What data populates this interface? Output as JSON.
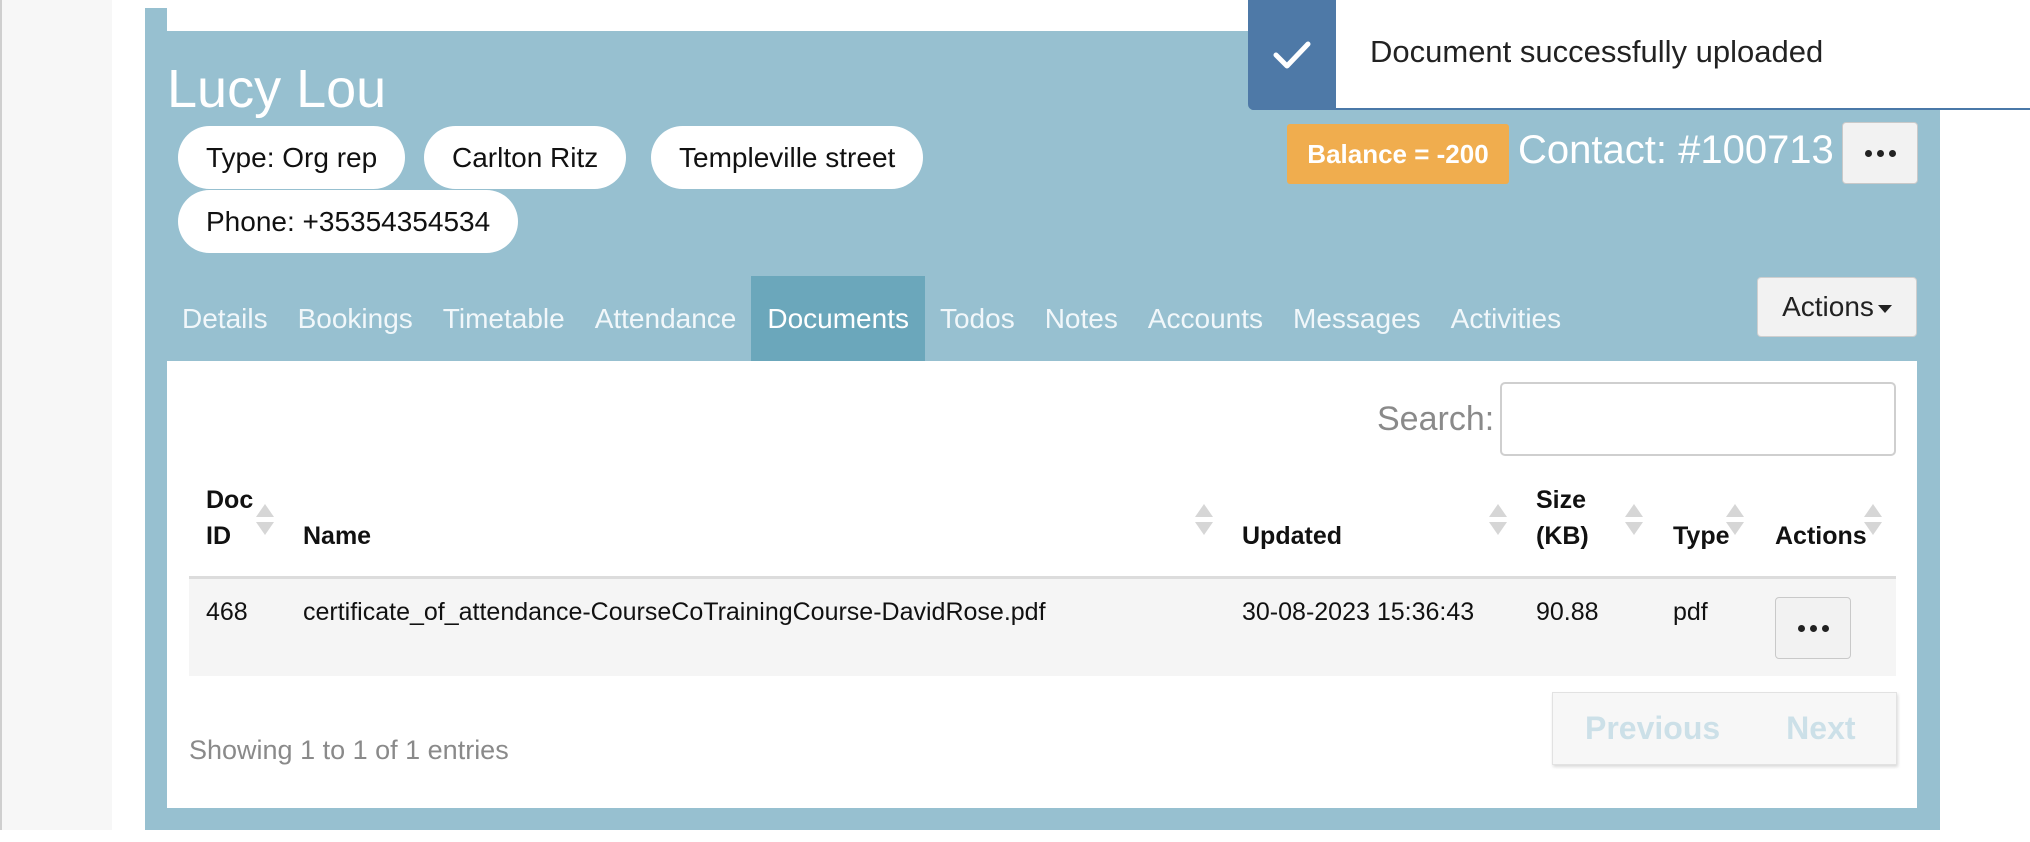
{
  "contact": {
    "name": "Lucy Lou",
    "pills": [
      "Type: Org rep",
      "Carlton Ritz",
      "Templeville street",
      "Phone: +35354354534"
    ],
    "balance": "Balance = -200",
    "contact_id": "Contact: #100713"
  },
  "tabs": [
    {
      "label": "Details",
      "active": false
    },
    {
      "label": "Bookings",
      "active": false
    },
    {
      "label": "Timetable",
      "active": false
    },
    {
      "label": "Attendance",
      "active": false
    },
    {
      "label": "Documents",
      "active": true
    },
    {
      "label": "Todos",
      "active": false
    },
    {
      "label": "Notes",
      "active": false
    },
    {
      "label": "Accounts",
      "active": false
    },
    {
      "label": "Messages",
      "active": false
    },
    {
      "label": "Activities",
      "active": false
    }
  ],
  "actions_label": "Actions",
  "search": {
    "label": "Search:",
    "value": ""
  },
  "table": {
    "headers": {
      "doc_id_1": "Doc",
      "doc_id_2": "ID",
      "name": "Name",
      "updated": "Updated",
      "size_1": "Size",
      "size_2": "(KB)",
      "type": "Type",
      "actions": "Actions"
    },
    "rows": [
      {
        "doc_id": "468",
        "name": "certificate_of_attendance-CourseCoTrainingCourse-DavidRose.pdf",
        "updated": "30-08-2023 15:36:43",
        "size": "90.88",
        "type": "pdf"
      }
    ]
  },
  "footer": {
    "showing": "Showing 1 to 1 of 1 entries",
    "previous": "Previous",
    "next": "Next"
  },
  "toast": {
    "message": "Document successfully uploaded",
    "icon": "check-icon"
  },
  "colors": {
    "panel": "#97c0d0",
    "active_tab": "#6ba7bb",
    "balance": "#f0ad4e",
    "toast_accent": "#4e79a7"
  }
}
